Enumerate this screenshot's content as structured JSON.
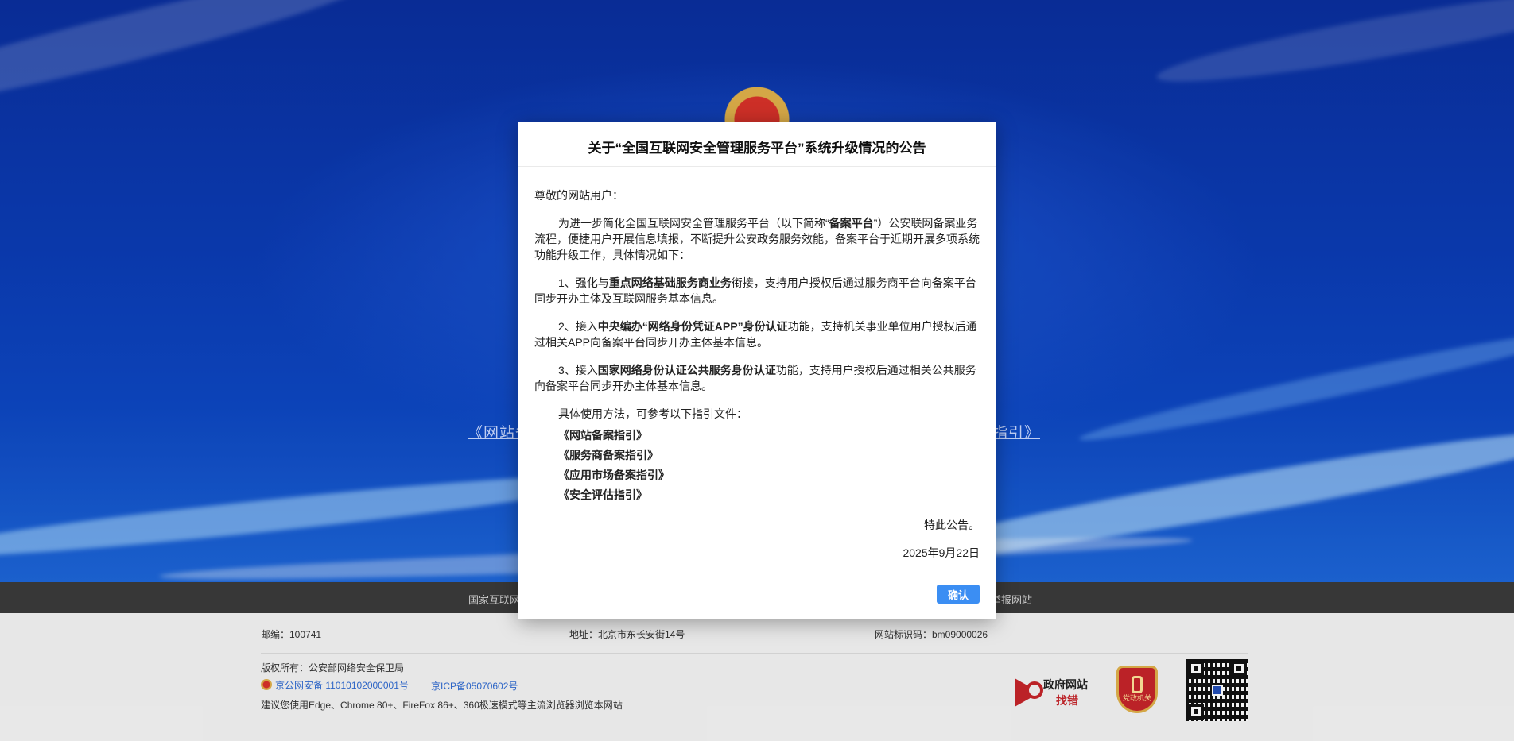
{
  "hero": {
    "link_left": "《网站备",
    "link_right": "指引》"
  },
  "footer": {
    "nav_left": "国家互联网",
    "nav_right": "举报网站",
    "postcode": "邮编：100741",
    "address": "地址：北京市东长安街14号",
    "site_id": "网站标识码：bm09000026",
    "copyright": "版权所有：公安部网络安全保卫局",
    "police_record": "京公网安备 11010102000001号",
    "icp_record": "京ICP备05070602号",
    "browser_tip": "建议您使用Edge、Chrome 80+、FireFox 86+、360极速模式等主流浏览器浏览本网站",
    "gov_logo_line1": "政府网站",
    "gov_logo_line2": "找错",
    "badge_text": "党政机关"
  },
  "modal": {
    "title": "关于“全国互联网安全管理服务平台”系统升级情况的公告",
    "greeting": "尊敬的网站用户：",
    "para1": {
      "a": "为进一步简化全国互联网安全管理服务平台（以下简称“",
      "b": "备案平台",
      "c": "”）公安联网备案业务流程，便捷用户开展信息填报，不断提升公安政务服务效能，备案平台于近期开展多项系统功能升级工作，具体情况如下："
    },
    "para2": {
      "a": "1、强化与",
      "b": "重点网络基础服务商业务",
      "c": "衔接，支持用户授权后通过服务商平台向备案平台同步开办主体及互联网服务基本信息。"
    },
    "para3": {
      "a": "2、接入",
      "b": "中央编办“网络身份凭证APP”身份认证",
      "c": "功能，支持机关事业单位用户授权后通过相关APP向备案平台同步开办主体基本信息。"
    },
    "para4": {
      "a": "3、接入",
      "b": "国家网络身份认证公共服务身份认证",
      "c": "功能，支持用户授权后通过相关公共服务向备案平台同步开办主体基本信息。"
    },
    "guide_intro": "具体使用方法，可参考以下指引文件：",
    "guides": [
      "《网站备案指引》",
      "《服务商备案指引》",
      "《应用市场备案指引》",
      "《安全评估指引》"
    ],
    "closing": "特此公告。",
    "date": "2025年9月22日",
    "confirm_label": "确认"
  }
}
